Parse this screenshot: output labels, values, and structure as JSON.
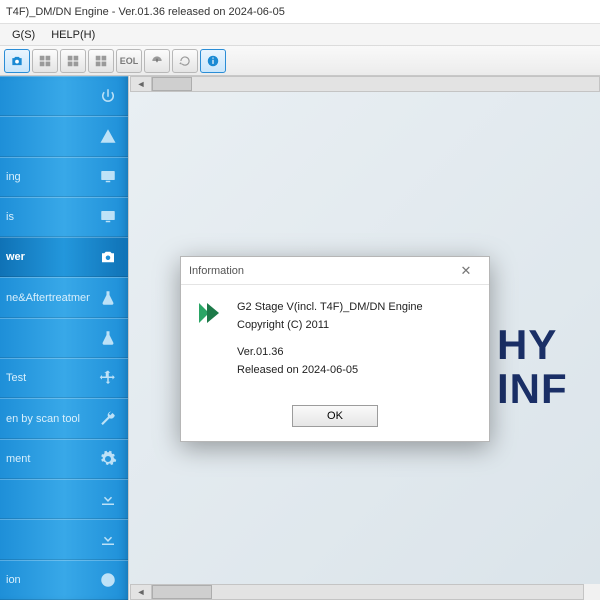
{
  "window": {
    "title": "T4F)_DM/DN Engine - Ver.01.36 released on 2024-06-05"
  },
  "menu": {
    "items": [
      "G(S)",
      "HELP(H)"
    ]
  },
  "toolbar": {
    "buttons": [
      "camera",
      "grid",
      "grid2",
      "grid3",
      "eol",
      "gauge",
      "cycle",
      "info"
    ],
    "eol_label": "EOL"
  },
  "sidebar": {
    "items": [
      {
        "label": ""
      },
      {
        "label": ""
      },
      {
        "label": "ing"
      },
      {
        "label": "is"
      },
      {
        "label": "wer"
      },
      {
        "label": "ne&Aftertreatment"
      },
      {
        "label": ""
      },
      {
        "label": " Test"
      },
      {
        "label": "en by scan tool"
      },
      {
        "label": "ment"
      },
      {
        "label": ""
      },
      {
        "label": ""
      },
      {
        "label": "ion"
      }
    ],
    "selected_index": 4
  },
  "logo": {
    "line1": "HY",
    "line2": "INF"
  },
  "dialog": {
    "title": "Information",
    "product": "G2 Stage V(incl. T4F)_DM/DN Engine",
    "copyright": "Copyright (C) 2011",
    "version": "Ver.01.36",
    "released": "Released on 2024-06-05",
    "ok": "OK"
  }
}
